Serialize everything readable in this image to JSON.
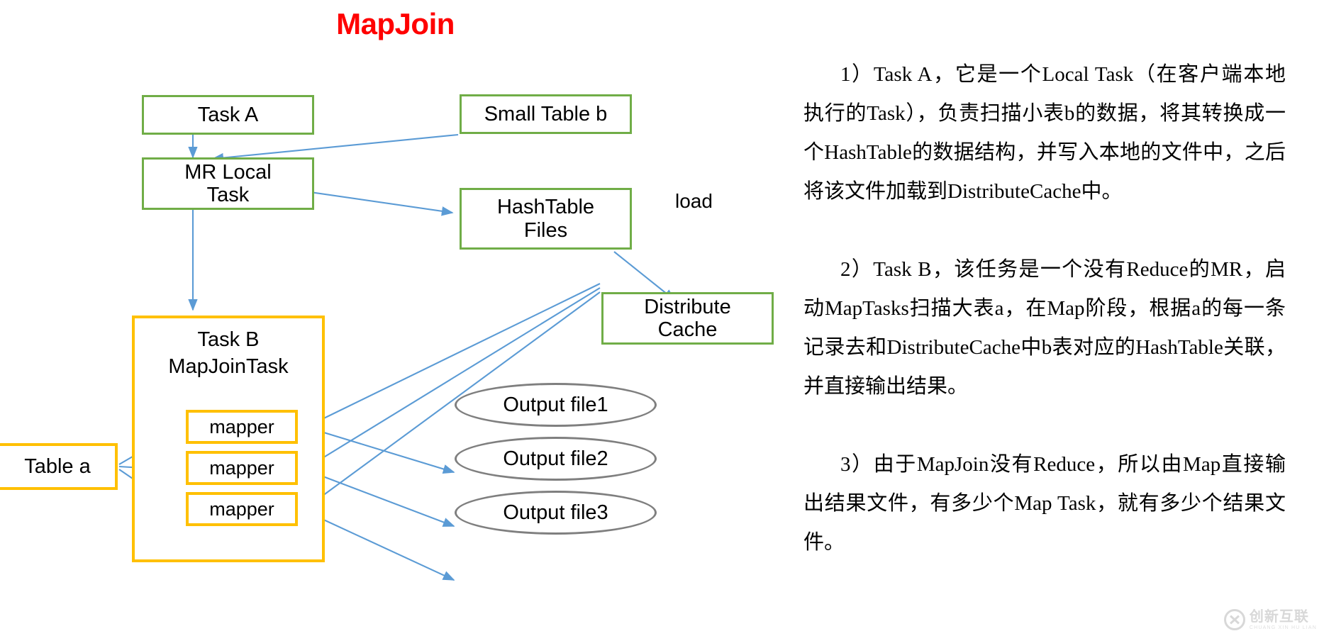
{
  "title": "MapJoin",
  "colors": {
    "title_red": "#FF0000",
    "green_border": "#70AD47",
    "orange_border": "#FFC000",
    "gray_border": "#7F7F7F",
    "arrow_blue": "#5B9BD5"
  },
  "diagram": {
    "nodes": {
      "task_a": "Task A",
      "small_table_b": "Small Table b",
      "mr_local_task": "MR Local\nTask",
      "mr_local_task_line1": "MR Local",
      "mr_local_task_line2": "Task",
      "hashtable_files_line1": "HashTable",
      "hashtable_files_line2": "Files",
      "distribute_cache_line1": "Distribute",
      "distribute_cache_line2": "Cache",
      "task_b_line1": "Task B",
      "task_b_line2": "MapJoinTask",
      "table_a": "Table a",
      "mapper1": "mapper",
      "mapper2": "mapper",
      "mapper3": "mapper",
      "output1": "Output file1",
      "output2": "Output file2",
      "output3": "Output file3"
    },
    "edge_labels": {
      "load": "load"
    }
  },
  "notes": [
    {
      "id": "note-1",
      "marker": "1）",
      "text": "Task A，它是一个Local Task（在客户端本地执行的Task），负责扫描小表b的数据，将其转换成一个HashTable的数据结构，并写入本地的文件中，之后将该文件加载到DistributeCache中。"
    },
    {
      "id": "note-2",
      "marker": "2）",
      "text": "Task B，该任务是一个没有Reduce的MR，启动MapTasks扫描大表a，在Map阶段，根据a的每一条记录去和DistributeCache中b表对应的HashTable关联，并直接输出结果。"
    },
    {
      "id": "note-3",
      "marker": "3）",
      "text": "由于MapJoin没有Reduce，所以由Map直接输出结果文件，有多少个Map Task，就有多少个结果文件。"
    }
  ],
  "watermark": {
    "cn": "创新互联",
    "en": "CHUANG XIN HU LIAN"
  }
}
